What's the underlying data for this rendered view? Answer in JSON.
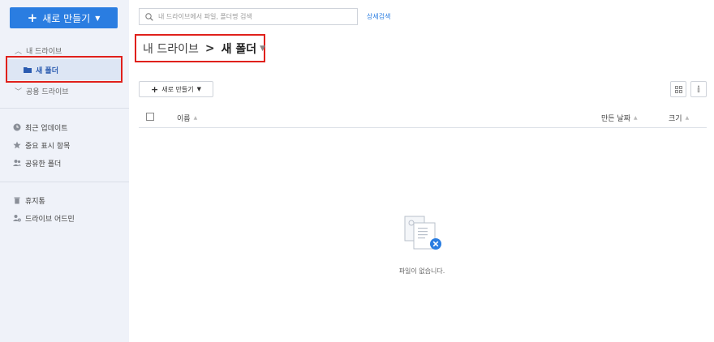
{
  "sidebar": {
    "new_button_label": "새로 만들기",
    "my_drive_label": "내 드라이브",
    "current_folder_label": "새 폴더",
    "shared_drive_label": "공용 드라이브",
    "menu": [
      {
        "label": "최근 업데이트",
        "icon": "clock-icon"
      },
      {
        "label": "중요 표시 항목",
        "icon": "star-icon"
      },
      {
        "label": "공유한 폴더",
        "icon": "shared-users-icon"
      }
    ],
    "menu2": [
      {
        "label": "휴지통",
        "icon": "trash-icon"
      },
      {
        "label": "드라이브 어드민",
        "icon": "admin-user-icon"
      }
    ]
  },
  "search": {
    "placeholder": "내 드라이브에서 파일, 폴더명 검색",
    "advanced_label": "상세검색"
  },
  "breadcrumb": {
    "root": "내 드라이브",
    "separator": ">",
    "current": "새 폴더"
  },
  "toolbar": {
    "new_label": "새로 만들기"
  },
  "table": {
    "columns": {
      "name": "이름",
      "created": "만든 날짜",
      "size": "크기"
    }
  },
  "empty_state": {
    "message": "파일이 없습니다."
  },
  "colors": {
    "accent": "#2a7de1",
    "sidebar_bg": "#eff2f9",
    "highlight_border": "#e0201b"
  }
}
